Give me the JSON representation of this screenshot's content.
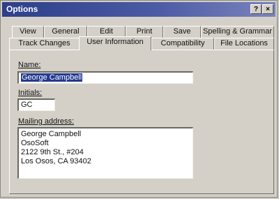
{
  "window": {
    "title": "Options"
  },
  "titlebar_buttons": {
    "help": "?",
    "close": "×"
  },
  "tabs_row1": [
    "View",
    "General",
    "Edit",
    "Print",
    "Save",
    "Spelling & Grammar"
  ],
  "tabs_row2": [
    "Track Changes",
    "User Information",
    "Compatibility",
    "File Locations"
  ],
  "active_tab": "User Information",
  "form": {
    "name_label": "Name:",
    "name_value": "George Campbell",
    "initials_label": "Initials:",
    "initials_value": "GC",
    "address_label": "Mailing address:",
    "address_lines": [
      "George Campbell",
      "OsoSoft",
      "2122 9th St., #204",
      "Los Osos, CA  93402"
    ]
  }
}
